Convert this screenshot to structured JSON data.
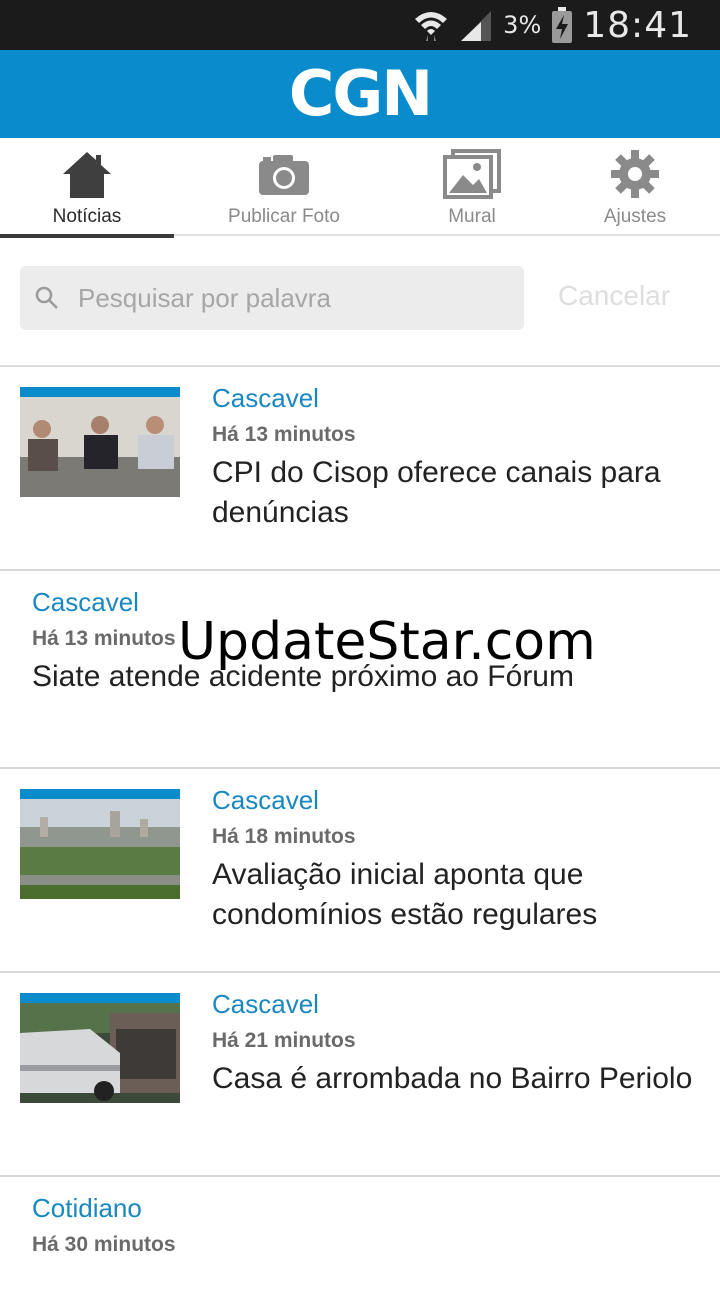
{
  "status_bar": {
    "battery_percent": "3%",
    "time": "18:41"
  },
  "app": {
    "logo_text": "CGN",
    "brand_color": "#0a8ccc"
  },
  "tabs": [
    {
      "label": "Notícias",
      "icon": "home-icon",
      "active": true
    },
    {
      "label": "Publicar Foto",
      "icon": "camera-icon",
      "active": false
    },
    {
      "label": "Mural",
      "icon": "gallery-icon",
      "active": false
    },
    {
      "label": "Ajustes",
      "icon": "gear-icon",
      "active": false
    }
  ],
  "search": {
    "placeholder": "Pesquisar por palavra",
    "cancel_label": "Cancelar"
  },
  "news": [
    {
      "category": "Cascavel",
      "time": "Há 13 minutos",
      "title": "CPI do Cisop oferece canais para denúncias",
      "has_image": true
    },
    {
      "category": "Cascavel",
      "time": "Há 13 minutos",
      "title": "Siate atende acidente próximo ao Fórum",
      "has_image": false
    },
    {
      "category": "Cascavel",
      "time": "Há 18 minutos",
      "title": "Avaliação inicial aponta que condomínios estão regulares",
      "has_image": true
    },
    {
      "category": "Cascavel",
      "time": "Há 21 minutos",
      "title": "Casa é arrombada no Bairro Periolo",
      "has_image": true
    },
    {
      "category": "Cotidiano",
      "time": "Há 30 minutos",
      "title": "",
      "has_image": false
    }
  ],
  "watermark": "UpdateStar.com"
}
